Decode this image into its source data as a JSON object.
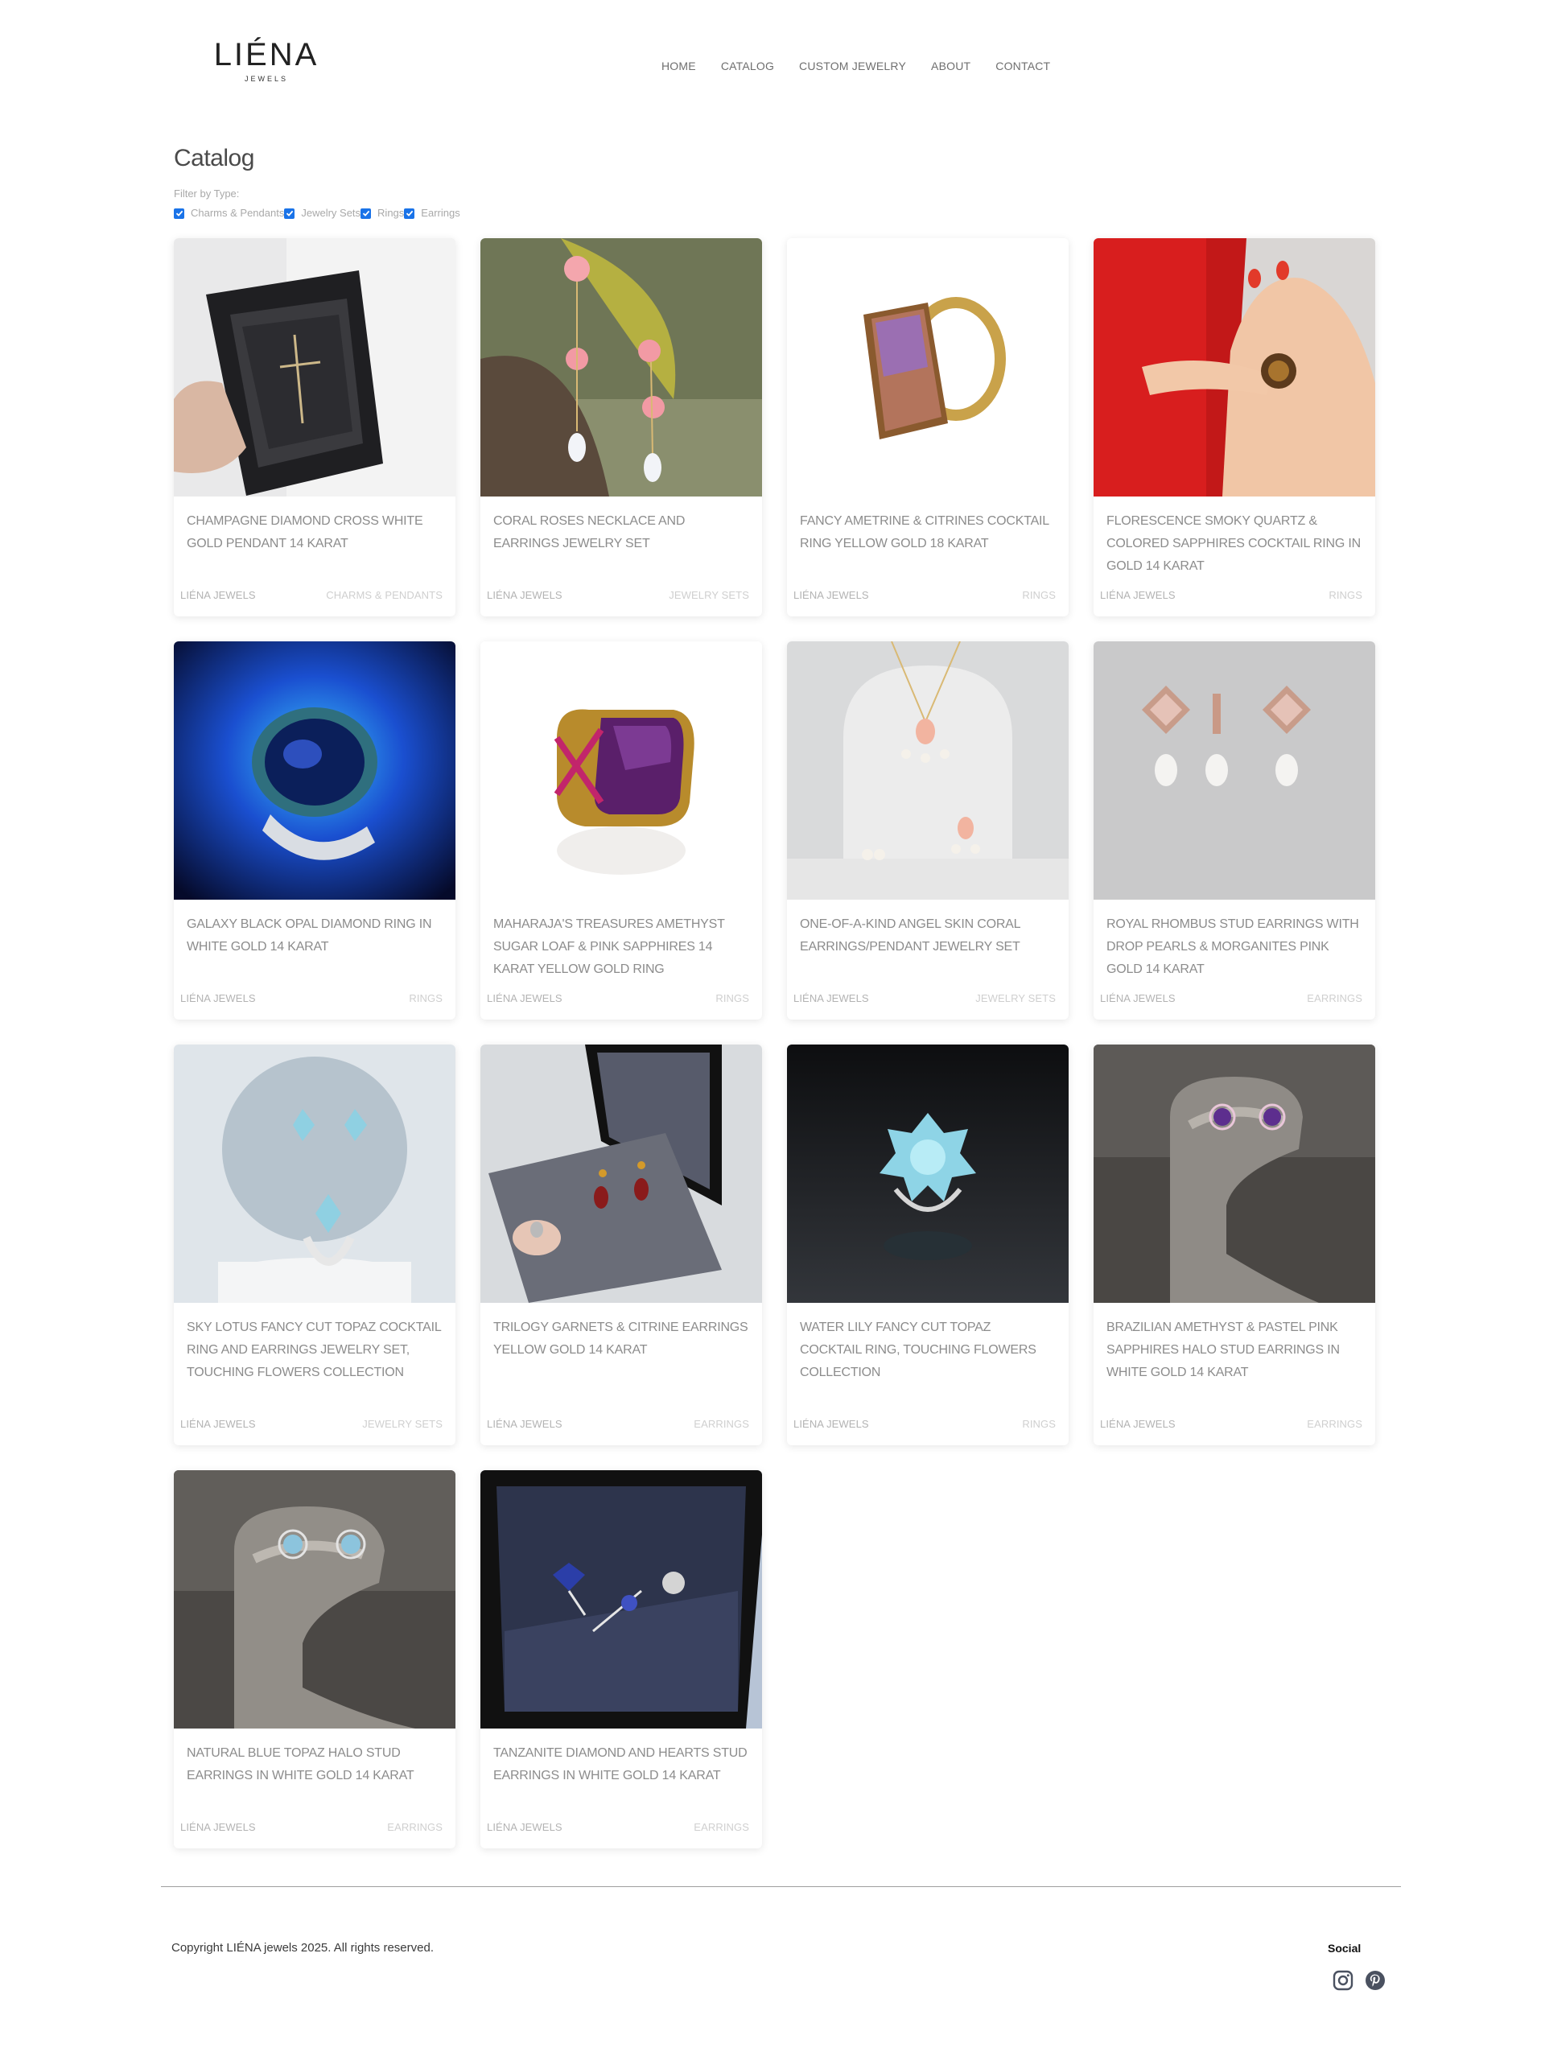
{
  "brand": {
    "name": "LIÉNA",
    "tagline": "JEWELS"
  },
  "nav": [
    {
      "label": "HOME"
    },
    {
      "label": "CATALOG"
    },
    {
      "label": "CUSTOM JEWELRY"
    },
    {
      "label": "ABOUT"
    },
    {
      "label": "CONTACT"
    }
  ],
  "catalog": {
    "title": "Catalog",
    "filter_label": "Filter by Type:",
    "filters": [
      {
        "label": "Charms & Pendants",
        "checked": true
      },
      {
        "label": "Jewelry Sets",
        "checked": true
      },
      {
        "label": "Rings",
        "checked": true
      },
      {
        "label": "Earrings",
        "checked": true
      }
    ]
  },
  "products": [
    {
      "title": "CHAMPAGNE DIAMOND CROSS WHITE GOLD PENDANT 14 KARAT",
      "brand": "LIÉNA JEWELS",
      "category": "CHARMS & PENDANTS",
      "image": "pendant-box-photo"
    },
    {
      "title": "CORAL ROSES NECKLACE AND EARRINGS JEWELRY SET",
      "brand": "LIÉNA JEWELS",
      "category": "JEWELRY SETS",
      "image": "coral-earrings-photo"
    },
    {
      "title": "FANCY AMETRINE & CITRINES COCKTAIL RING YELLOW GOLD 18 KARAT",
      "brand": "LIÉNA JEWELS",
      "category": "RINGS",
      "image": "ametrine-ring-photo"
    },
    {
      "title": "FLORESCENCE SMOKY QUARTZ & COLORED SAPPHIRES COCKTAIL RING IN GOLD 14 KARAT",
      "brand": "LIÉNA JEWELS",
      "category": "RINGS",
      "image": "hand-ring-photo"
    },
    {
      "title": "GALAXY BLACK OPAL DIAMOND RING IN WHITE GOLD 14 KARAT",
      "brand": "LIÉNA JEWELS",
      "category": "RINGS",
      "image": "opal-ring-photo"
    },
    {
      "title": "MAHARAJA'S TREASURES AMETHYST SUGAR LOAF & PINK SAPPHIRES 14 KARAT YELLOW GOLD RING",
      "brand": "LIÉNA JEWELS",
      "category": "RINGS",
      "image": "amethyst-ring-photo"
    },
    {
      "title": "ONE-OF-A-KIND ANGEL SKIN CORAL EARRINGS/PENDANT JEWELRY SET",
      "brand": "LIÉNA JEWELS",
      "category": "JEWELRY SETS",
      "image": "angel-skin-set-photo"
    },
    {
      "title": "ROYAL RHOMBUS STUD EARRINGS WITH DROP PEARLS & MORGANITES PINK GOLD 14 KARAT",
      "brand": "LIÉNA JEWELS",
      "category": "EARRINGS",
      "image": "rhombus-earrings-photo"
    },
    {
      "title": "SKY LOTUS FANCY CUT TOPAZ COCKTAIL RING AND EARRINGS JEWELRY SET, TOUCHING FLOWERS COLLECTION",
      "brand": "LIÉNA JEWELS",
      "category": "JEWELRY SETS",
      "image": "sky-lotus-set-photo"
    },
    {
      "title": "TRILOGY GARNETS & CITRINE EARRINGS YELLOW GOLD 14 KARAT",
      "brand": "LIÉNA JEWELS",
      "category": "EARRINGS",
      "image": "garnet-earrings-photo"
    },
    {
      "title": "WATER LILY FANCY CUT TOPAZ COCKTAIL RING, TOUCHING FLOWERS COLLECTION",
      "brand": "LIÉNA JEWELS",
      "category": "RINGS",
      "image": "water-lily-ring-photo"
    },
    {
      "title": "BRAZILIAN AMETHYST & PASTEL PINK SAPPHIRES HALO STUD EARRINGS IN WHITE GOLD 14 KARAT",
      "brand": "LIÉNA JEWELS",
      "category": "EARRINGS",
      "image": "amethyst-studs-photo"
    },
    {
      "title": "NATURAL BLUE TOPAZ HALO STUD EARRINGS IN WHITE GOLD 14 KARAT",
      "brand": "LIÉNA JEWELS",
      "category": "EARRINGS",
      "image": "topaz-studs-photo"
    },
    {
      "title": "TANZANITE DIAMOND AND HEARTS STUD EARRINGS IN WHITE GOLD 14 KARAT",
      "brand": "LIÉNA JEWELS",
      "category": "EARRINGS",
      "image": "tanzanite-studs-photo"
    }
  ],
  "footer": {
    "copyright": "Copyright LIÉNA jewels 2025. All rights reserved.",
    "social_title": "Social",
    "social_icons": [
      "instagram-icon",
      "pinterest-icon"
    ]
  },
  "colors": {
    "checkbox": "#1a73e8",
    "text_muted": "#8c8c8c",
    "divider": "#9e9e9e"
  }
}
